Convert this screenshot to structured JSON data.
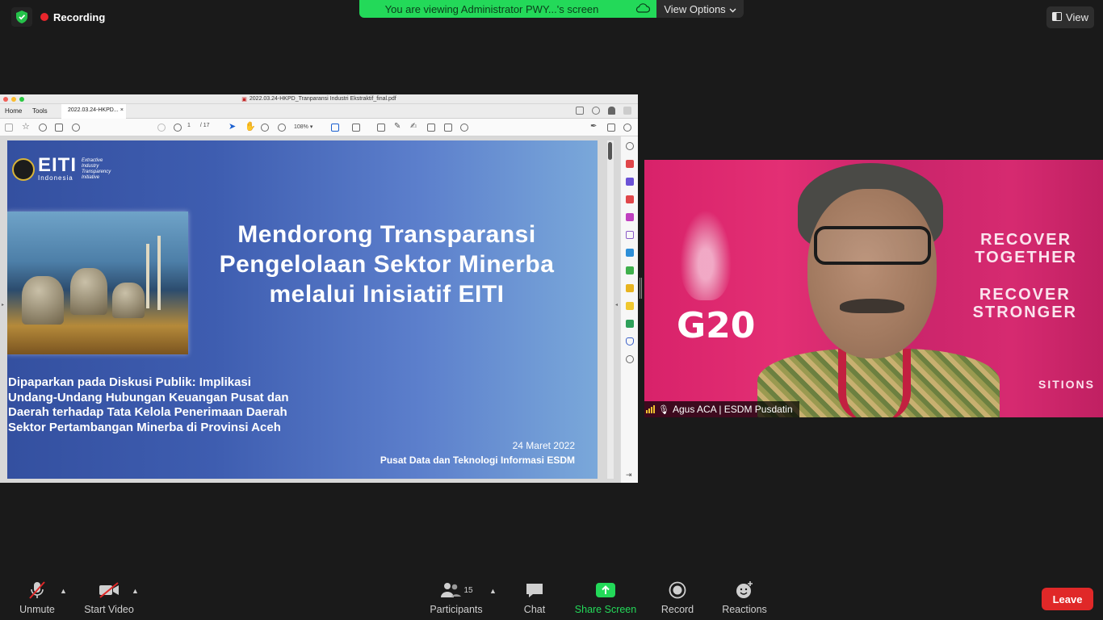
{
  "top": {
    "recording_label": "Recording",
    "banner_text": "You are viewing Administrator PWY...'s screen",
    "view_options_label": "View Options",
    "view_label": "View"
  },
  "pdf_window": {
    "filename": "2022.03.24-HKPD_Tranparansi Industri Ekstraktif_final.pdf",
    "menu_home": "Home",
    "menu_tools": "Tools",
    "tab_label": "2022.03.24-HKPD...",
    "tab_close": "×",
    "page_current": "1",
    "page_total": "/ 17",
    "zoom": "108%"
  },
  "slide": {
    "logo_text": "EITI",
    "logo_country": "Indonesia",
    "logo_tagline_1": "Extractive",
    "logo_tagline_2": "Industry",
    "logo_tagline_3": "Transparency",
    "logo_tagline_4": "Initiative",
    "title_line1": "Mendorong Transparansi",
    "title_line2": "Pengelolaan Sektor Minerba",
    "title_line3": "melalui Inisiatif EITI",
    "subtitle_line1": "Dipaparkan pada Diskusi Publik: Implikasi",
    "subtitle_line2": "Undang-Undang Hubungan Keuangan Pusat dan",
    "subtitle_line3": "Daerah terhadap Tata Kelola Penerimaan Daerah",
    "subtitle_line4": "Sektor Pertambangan Minerba di Provinsi Aceh",
    "date": "24 Maret 2022",
    "organization": "Pusat Data dan Teknologi Informasi ESDM"
  },
  "video": {
    "participant_name": "Agus ACA | ESDM Pusdatin",
    "bg_g20": "G20",
    "bg_recover1_a": "RECOVER",
    "bg_recover1_b": "TOGETHER",
    "bg_recover2_a": "RECOVER",
    "bg_recover2_b": "STRONGER",
    "bg_transitions": "SITIONS"
  },
  "toolbar": {
    "unmute": "Unmute",
    "start_video": "Start Video",
    "participants": "Participants",
    "participants_count": "15",
    "chat": "Chat",
    "share_screen": "Share Screen",
    "record": "Record",
    "reactions": "Reactions",
    "leave": "Leave"
  },
  "colors": {
    "share_green": "#23d959",
    "leave_red": "#e02828",
    "toolbar_bg": "#1a1a1a"
  }
}
